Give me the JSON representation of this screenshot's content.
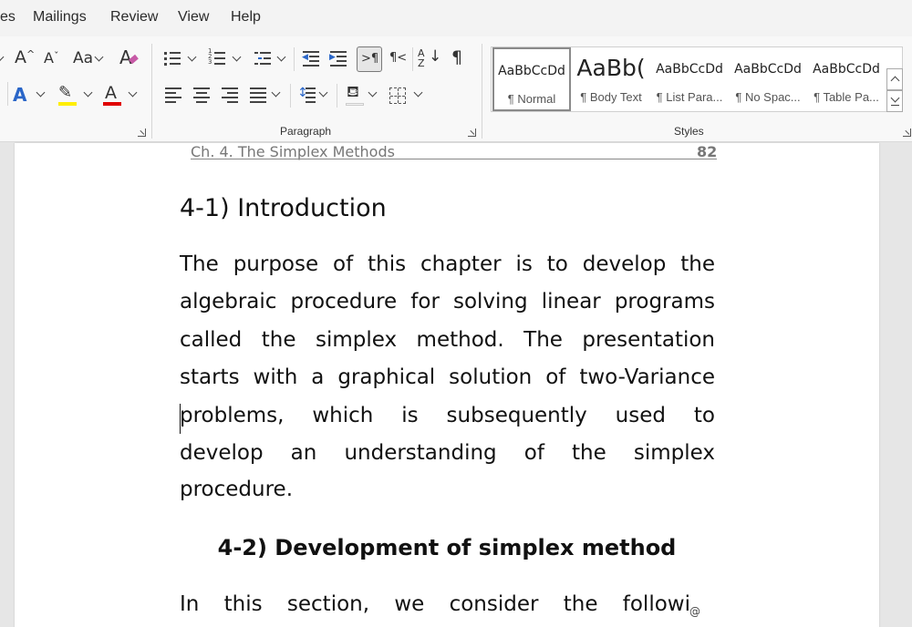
{
  "ribbon_tabs": [
    "es",
    "Mailings",
    "Review",
    "View",
    "Help"
  ],
  "font_group": {
    "grow_font": "A",
    "shrink_font": "A",
    "change_case": "Aa"
  },
  "paragraph_group": {
    "label": "Paragraph"
  },
  "styles_group": {
    "label": "Styles",
    "styles": [
      {
        "preview": "AaBbCcDd",
        "name": "¶ Normal"
      },
      {
        "preview": "AaBb(",
        "name": "¶ Body Text"
      },
      {
        "preview": "AaBbCcDd",
        "name": "¶ List Para..."
      },
      {
        "preview": "AaBbCcDd",
        "name": "¶ No Spac..."
      },
      {
        "preview": "AaBbCcDd",
        "name": "¶ Table Pa..."
      }
    ]
  },
  "document": {
    "header_title": "Ch. 4. The Simplex Methods",
    "page_number": "82",
    "heading1": "4-1) Introduction",
    "paragraph_lines": [
      "The purpose of this chapter is to develop the",
      "algebraic procedure for solving linear programs",
      "called the simplex method. The presentation",
      "starts with a graphical solution of two-Variance",
      "problems, which is subsequently used to",
      "develop an understanding of the simplex",
      "procedure."
    ],
    "heading2": "4-2) Development of simplex method",
    "next_line": "In this section, we consider the followi",
    "overlay_text": "‌@"
  }
}
